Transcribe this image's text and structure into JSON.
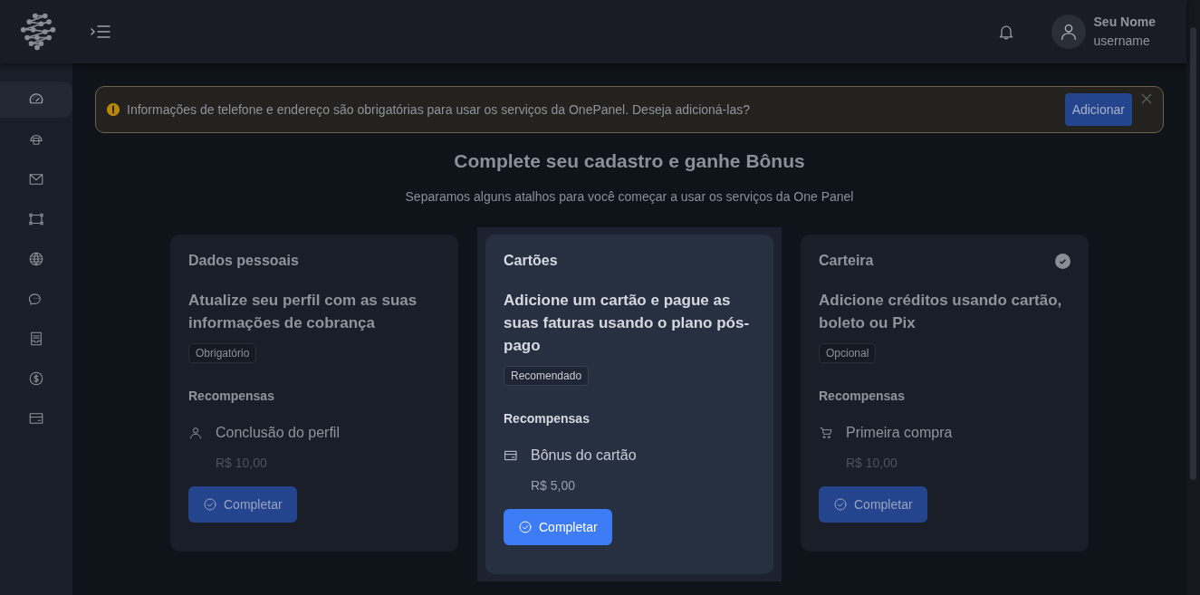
{
  "header": {
    "user": {
      "name": "Seu Nome",
      "username": "username"
    }
  },
  "sidebar": {
    "items": [
      {
        "selected": true
      },
      {
        "selected": false
      },
      {
        "selected": false
      },
      {
        "selected": false
      },
      {
        "selected": false
      },
      {
        "selected": false
      },
      {
        "selected": false
      },
      {
        "selected": false
      },
      {
        "selected": false
      }
    ]
  },
  "alert": {
    "message": "Informações de telefone e endereço são obrigatórias para usar os serviços da OnePanel. Deseja adicioná-las?",
    "action": "Adicionar"
  },
  "intro": {
    "title": "Complete seu cadastro e ganhe Bônus",
    "subtitle": "Separamos alguns atalhos para você começar a usar os serviços da One Panel"
  },
  "cards": [
    {
      "title": "Dados pessoais",
      "completed": false,
      "selected": false,
      "description": "Atualize seu perfil com as suas informações de cobrança",
      "tag": "Obrigatório",
      "rewards_label": "Recompensas",
      "reward": "Conclusão do perfil",
      "amount": "R$ 10,00",
      "button": "Completar"
    },
    {
      "title": "Cartões",
      "completed": false,
      "selected": true,
      "description": "Adicione um cartão e pague as suas faturas usando o plano pós-pago",
      "tag": "Recomendado",
      "rewards_label": "Recompensas",
      "reward": "Bônus do cartão",
      "amount": "R$ 5,00",
      "button": "Completar"
    },
    {
      "title": "Carteira",
      "completed": true,
      "selected": false,
      "description": "Adicione créditos usando cartão, boleto ou Pix",
      "tag": "Opcional",
      "rewards_label": "Recompensas",
      "reward": "Primeira compra",
      "amount": "R$ 10,00",
      "button": "Completar"
    }
  ]
}
